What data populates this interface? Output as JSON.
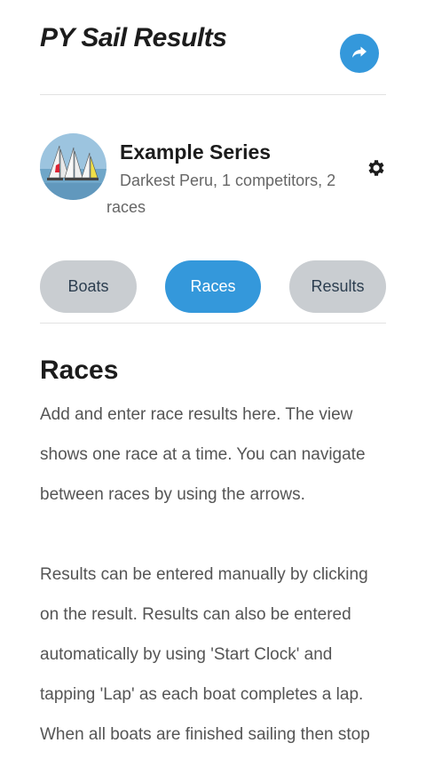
{
  "header": {
    "title": "PY Sail Results",
    "share_icon": "share-icon"
  },
  "series": {
    "name": "Example Series",
    "subtitle": "Darkest Peru, 1 competitors, 2 races",
    "avatar_icon": "sailboats-image",
    "settings_icon": "gear-icon"
  },
  "tabs": [
    {
      "label": "Boats",
      "active": false
    },
    {
      "label": "Races",
      "active": true
    },
    {
      "label": "Results",
      "active": false
    }
  ],
  "content": {
    "title": "Races",
    "paragraph1": "Add and enter race results here. The view shows one race at a time. You can navigate between races by using the arrows.",
    "paragraph2": "Results can be entered manually by clicking on the result. Results can also be entered automatically by using 'Start Clock' and tapping 'Lap' as each boat completes a lap. When all boats are finished sailing then stop"
  },
  "colors": {
    "accent": "#3498db",
    "tab_inactive": "#c9cdd1",
    "divider": "#e2e2e2"
  }
}
